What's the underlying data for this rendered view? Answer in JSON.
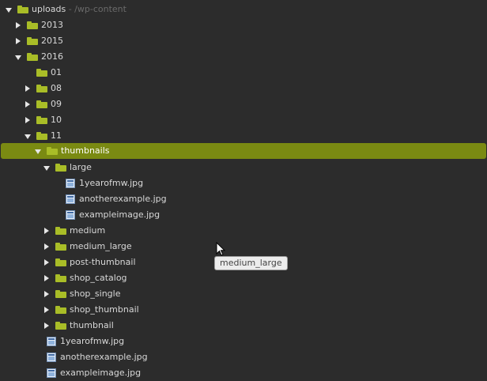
{
  "tree": {
    "rows": [
      {
        "label": "uploads",
        "sublabel": " - /wp-content",
        "type": "folder",
        "depth": 0,
        "arrow": "expanded",
        "selected": false
      },
      {
        "label": "2013",
        "type": "folder",
        "depth": 1,
        "arrow": "collapsed",
        "selected": false
      },
      {
        "label": "2015",
        "type": "folder",
        "depth": 1,
        "arrow": "collapsed",
        "selected": false
      },
      {
        "label": "2016",
        "type": "folder",
        "depth": 1,
        "arrow": "expanded",
        "selected": false
      },
      {
        "label": "01",
        "type": "folder",
        "depth": 2,
        "arrow": "none",
        "selected": false
      },
      {
        "label": "08",
        "type": "folder",
        "depth": 2,
        "arrow": "collapsed",
        "selected": false
      },
      {
        "label": "09",
        "type": "folder",
        "depth": 2,
        "arrow": "collapsed",
        "selected": false
      },
      {
        "label": "10",
        "type": "folder",
        "depth": 2,
        "arrow": "collapsed",
        "selected": false
      },
      {
        "label": "11",
        "type": "folder",
        "depth": 2,
        "arrow": "expanded",
        "selected": false
      },
      {
        "label": "thumbnails",
        "type": "folder",
        "depth": 3,
        "arrow": "expanded",
        "selected": true
      },
      {
        "label": "large",
        "type": "folder",
        "depth": 4,
        "arrow": "expanded",
        "selected": false
      },
      {
        "label": "1yearofmw.jpg",
        "type": "file",
        "depth": 5,
        "arrow": "none",
        "selected": false
      },
      {
        "label": "anotherexample.jpg",
        "type": "file",
        "depth": 5,
        "arrow": "none",
        "selected": false
      },
      {
        "label": "exampleimage.jpg",
        "type": "file",
        "depth": 5,
        "arrow": "none",
        "selected": false
      },
      {
        "label": "medium",
        "type": "folder",
        "depth": 4,
        "arrow": "collapsed",
        "selected": false
      },
      {
        "label": "medium_large",
        "type": "folder",
        "depth": 4,
        "arrow": "collapsed",
        "selected": false
      },
      {
        "label": "post-thumbnail",
        "type": "folder",
        "depth": 4,
        "arrow": "collapsed",
        "selected": false
      },
      {
        "label": "shop_catalog",
        "type": "folder",
        "depth": 4,
        "arrow": "collapsed",
        "selected": false
      },
      {
        "label": "shop_single",
        "type": "folder",
        "depth": 4,
        "arrow": "collapsed",
        "selected": false
      },
      {
        "label": "shop_thumbnail",
        "type": "folder",
        "depth": 4,
        "arrow": "collapsed",
        "selected": false
      },
      {
        "label": "thumbnail",
        "type": "folder",
        "depth": 4,
        "arrow": "collapsed",
        "selected": false
      },
      {
        "label": "1yearofmw.jpg",
        "type": "file",
        "depth": 3,
        "arrow": "none",
        "selected": false
      },
      {
        "label": "anotherexample.jpg",
        "type": "file",
        "depth": 3,
        "arrow": "none",
        "selected": false
      },
      {
        "label": "exampleimage.jpg",
        "type": "file",
        "depth": 3,
        "arrow": "none",
        "selected": false
      }
    ]
  },
  "tooltip": {
    "text": "medium_large"
  },
  "icons": {
    "folder": "folder-icon",
    "file": "image-file-icon",
    "expanded": "triangle-down-icon",
    "collapsed": "triangle-right-icon",
    "cursor": "mouse-pointer-icon"
  },
  "colors": {
    "background": "#2c2c2c",
    "selection": "#7a8a12",
    "folder": "#a9bd27",
    "text": "#d8d8d8",
    "sublabel": "#6a6a6a"
  }
}
